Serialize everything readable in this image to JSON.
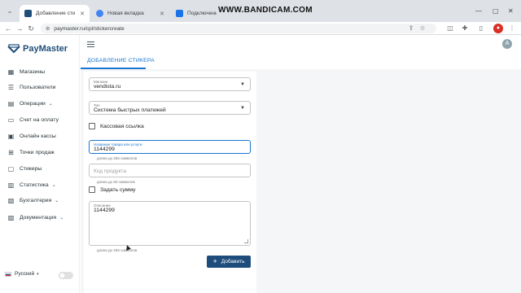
{
  "browser": {
    "tabs": [
      {
        "title": "Добавление стикера",
        "active": true,
        "favicon_color": "#1f4e79"
      },
      {
        "title": "Новая вкладка",
        "active": false,
        "favicon_color": "#4285f4"
      },
      {
        "title": "Подключение спо",
        "active": false,
        "favicon_color": "#1a73e8"
      }
    ],
    "watermark": "WWW.BANDICAM.COM",
    "url": "paymaster.ru/cpl/stickercreate"
  },
  "sidebar": {
    "logo": "PayMaster",
    "items": [
      {
        "label": "Магазины",
        "icon": "store-icon",
        "glyph": "▦",
        "has_chevron": false
      },
      {
        "label": "Пользователи",
        "icon": "users-icon",
        "glyph": "☰",
        "has_chevron": false
      },
      {
        "label": "Операции",
        "icon": "operations-icon",
        "glyph": "▤",
        "has_chevron": true
      },
      {
        "label": "Счет на оплату",
        "icon": "invoice-icon",
        "glyph": "▭",
        "has_chevron": false
      },
      {
        "label": "Онлайн кассы",
        "icon": "cash-register-icon",
        "glyph": "▣",
        "has_chevron": false
      },
      {
        "label": "Точки продаж",
        "icon": "sales-point-icon",
        "glyph": "⊞",
        "has_chevron": false
      },
      {
        "label": "Стикеры",
        "icon": "sticker-icon",
        "glyph": "▢",
        "has_chevron": false
      },
      {
        "label": "Статистика",
        "icon": "statistics-icon",
        "glyph": "▥",
        "has_chevron": true
      },
      {
        "label": "Бухгалтерия",
        "icon": "accounting-icon",
        "glyph": "▧",
        "has_chevron": true
      },
      {
        "label": "Документация",
        "icon": "docs-icon",
        "glyph": "▨",
        "has_chevron": true
      }
    ],
    "language": "Русский"
  },
  "header": {
    "page_tab": "ДОБАВЛЕНИЕ СТИКЕРА",
    "avatar_letter": "A"
  },
  "form": {
    "store": {
      "label": "Магазин",
      "value": "vendista.ru"
    },
    "type": {
      "label": "Тип",
      "value": "Система быстрых платежей"
    },
    "cash_link_label": "Кассовая ссылка",
    "product_name": {
      "label": "Название товара или услуги",
      "value": "1144299",
      "helper": "длина до 255 символов"
    },
    "product_code": {
      "placeholder": "Код продукта",
      "helper": "длина до 50 символов"
    },
    "set_amount_label": "Задать сумму",
    "description": {
      "label": "Описание",
      "value": "1144299",
      "helper": "длина до 255 символов"
    },
    "add_button": "Добавить"
  },
  "colors": {
    "accent": "#1976d2",
    "brand": "#1e4d7b"
  }
}
